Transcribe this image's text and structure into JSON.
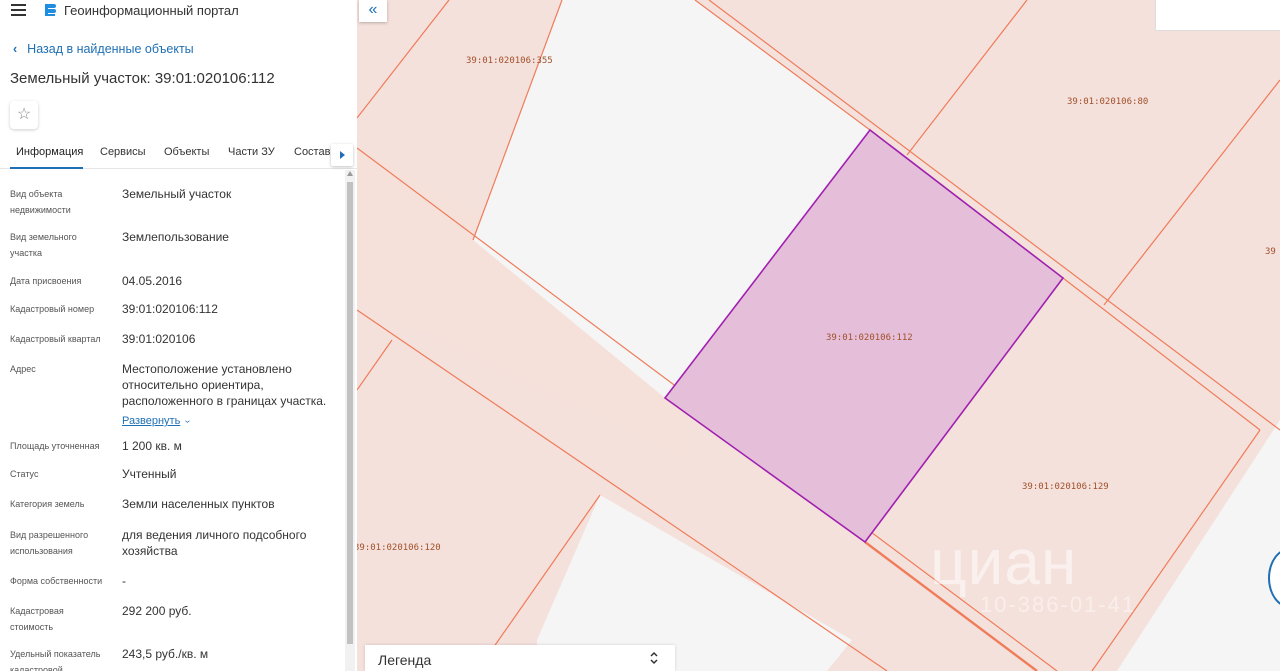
{
  "app": {
    "title": "Геоинформационный портал"
  },
  "nav": {
    "back_label": "Назад в найденные объекты"
  },
  "object": {
    "title": "Земельный участок: 39:01:020106:112"
  },
  "tabs": [
    {
      "label": "Информация",
      "active": true
    },
    {
      "label": "Сервисы"
    },
    {
      "label": "Объекты"
    },
    {
      "label": "Части ЗУ"
    },
    {
      "label": "Состав"
    }
  ],
  "details": [
    {
      "label": "Вид объекта недвижимости",
      "value": "Земельный участок"
    },
    {
      "label": "Вид земельного участка",
      "value": "Землепользование"
    },
    {
      "label": "Дата присвоения",
      "value": "04.05.2016"
    },
    {
      "label": "Кадастровый номер",
      "value": "39:01:020106:112"
    },
    {
      "label": "Кадастровый квартал",
      "value": "39:01:020106"
    },
    {
      "label": "Адрес",
      "value": "Местоположение установлено относительно ориентира, расположенного в границах участка.",
      "expand": "Развернуть"
    },
    {
      "label": "Площадь уточненная",
      "value": "1 200 кв. м"
    },
    {
      "label": "Статус",
      "value": "Учтенный"
    },
    {
      "label": "Категория земель",
      "value": "Земли населенных пунктов"
    },
    {
      "label": "Вид разрешенного использования",
      "value": "для ведения личного подсобного хозяйства"
    },
    {
      "label": "Форма собственности",
      "value": "-"
    },
    {
      "label": "Кадастровая стоимость",
      "value": "292 200 руб."
    },
    {
      "label": "Удельный показатель кадастровой",
      "value": "243,5 руб./кв. м"
    }
  ],
  "map": {
    "parcels": {
      "p355": "39:01:020106:355",
      "p80": "39:01:020106:80",
      "p112": "39:01:020106:112",
      "p129": "39:01:020106:129",
      "p120": "39:01:020106:120",
      "edge": "39"
    },
    "legend_label": "Легенда",
    "watermark": "циан",
    "watermark_phone": "10-386-01-41",
    "colors": {
      "selected_fill": "#e5bfd9",
      "selected_stroke": "#a020b0",
      "parcel_line": "#ef7c5a"
    }
  }
}
